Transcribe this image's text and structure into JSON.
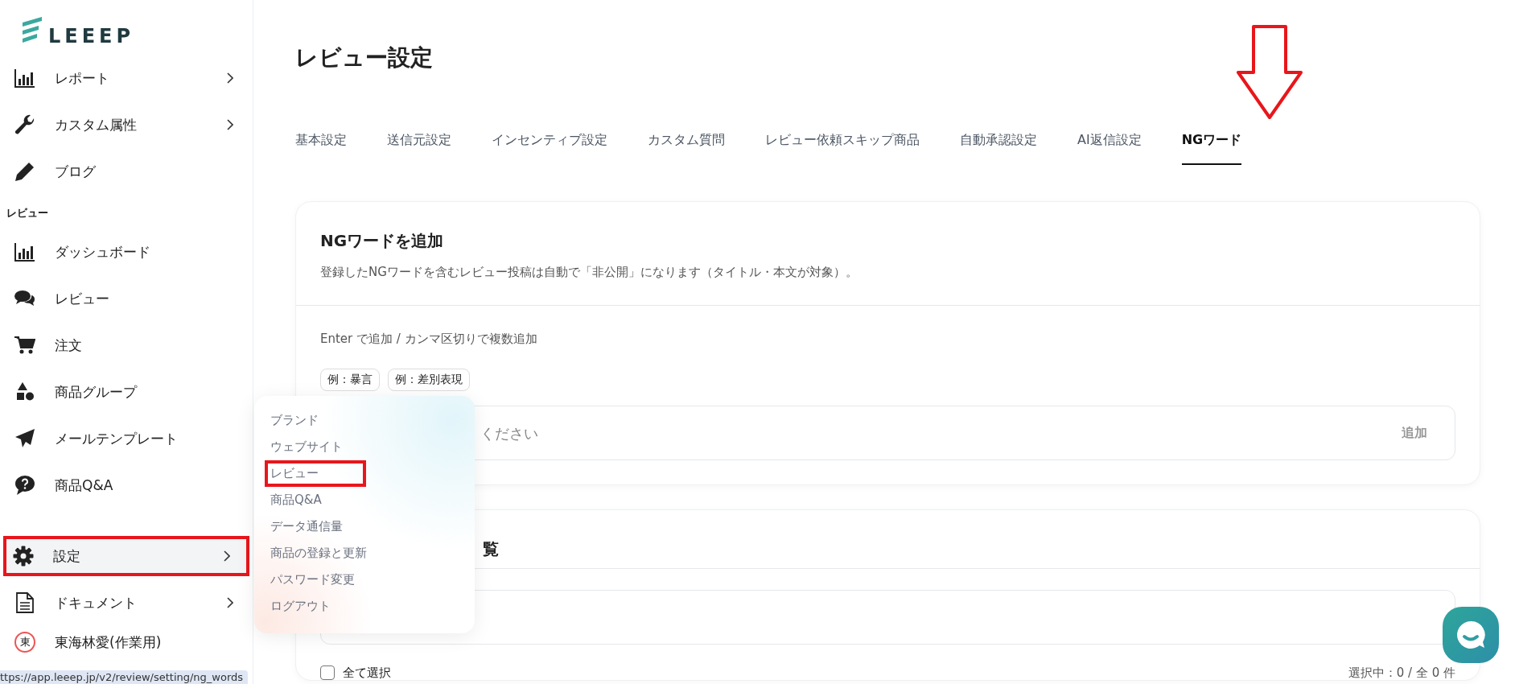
{
  "sidebar": {
    "logo": "LEEEP",
    "items": [
      {
        "kind": "item",
        "label": "レポート",
        "has_arrow": true,
        "highlighted": false
      },
      {
        "kind": "item",
        "label": "カスタム属性",
        "has_arrow": true,
        "highlighted": false
      },
      {
        "kind": "item",
        "label": "ブログ",
        "has_arrow": false,
        "highlighted": false
      },
      {
        "kind": "section",
        "label": "レビュー"
      },
      {
        "kind": "item",
        "label": "ダッシュボード",
        "has_arrow": false,
        "highlighted": false
      },
      {
        "kind": "item",
        "label": "レビュー",
        "has_arrow": false,
        "highlighted": false
      },
      {
        "kind": "item",
        "label": "注文",
        "has_arrow": false,
        "highlighted": false
      },
      {
        "kind": "item",
        "label": "商品グループ",
        "has_arrow": false,
        "highlighted": false
      },
      {
        "kind": "item",
        "label": "メールテンプレート",
        "has_arrow": false,
        "highlighted": false
      },
      {
        "kind": "item",
        "label": "商品Q&A",
        "has_arrow": false,
        "highlighted": false
      },
      {
        "kind": "item",
        "label": "設定",
        "has_arrow": true,
        "highlighted": true
      },
      {
        "kind": "item",
        "label": "ドキュメント",
        "has_arrow": true,
        "highlighted": false
      },
      {
        "kind": "user",
        "avatar": "東",
        "label": "東海林愛(作業用)"
      }
    ]
  },
  "settings_menu": [
    {
      "label": "ブランド",
      "highlighted": false
    },
    {
      "label": "ウェブサイト",
      "highlighted": false
    },
    {
      "label": "レビュー",
      "highlighted": true
    },
    {
      "label": "商品Q&A",
      "highlighted": false
    },
    {
      "label": "データ通信量",
      "highlighted": false
    },
    {
      "label": "商品の登録と更新",
      "highlighted": false
    },
    {
      "label": "パスワード変更",
      "highlighted": false
    },
    {
      "label": "ログアウト",
      "highlighted": false
    }
  ],
  "page": {
    "title": "レビュー設定"
  },
  "tabs": [
    {
      "label": "基本設定",
      "selected": false
    },
    {
      "label": "送信元設定",
      "selected": false
    },
    {
      "label": "インセンティブ設定",
      "selected": false
    },
    {
      "label": "カスタム質問",
      "selected": false
    },
    {
      "label": "レビュー依頼スキップ商品",
      "selected": false
    },
    {
      "label": "自動承認設定",
      "selected": false
    },
    {
      "label": "AI返信設定",
      "selected": false
    },
    {
      "label": "NGワード",
      "selected": true
    }
  ],
  "add_card": {
    "title": "NGワードを追加",
    "description": "登録したNGワードを含むレビュー投稿は自動で「非公開」になります（タイトル・本文が対象）。",
    "hint": "Enter で追加 / カンマ区切りで複数追加",
    "examples": [
      "例：暴言",
      "例：差別表現"
    ],
    "input": {
      "placeholder": "ください"
    },
    "add_button": "追加"
  },
  "list_card": {
    "title": "覧",
    "select_all": {
      "label": "全て選択",
      "checked": false
    },
    "count": "選択中：0 / 全 0 件"
  },
  "status_bar": {
    "url": "ttps://app.leeep.jp/v2/review/setting/ng_words"
  }
}
